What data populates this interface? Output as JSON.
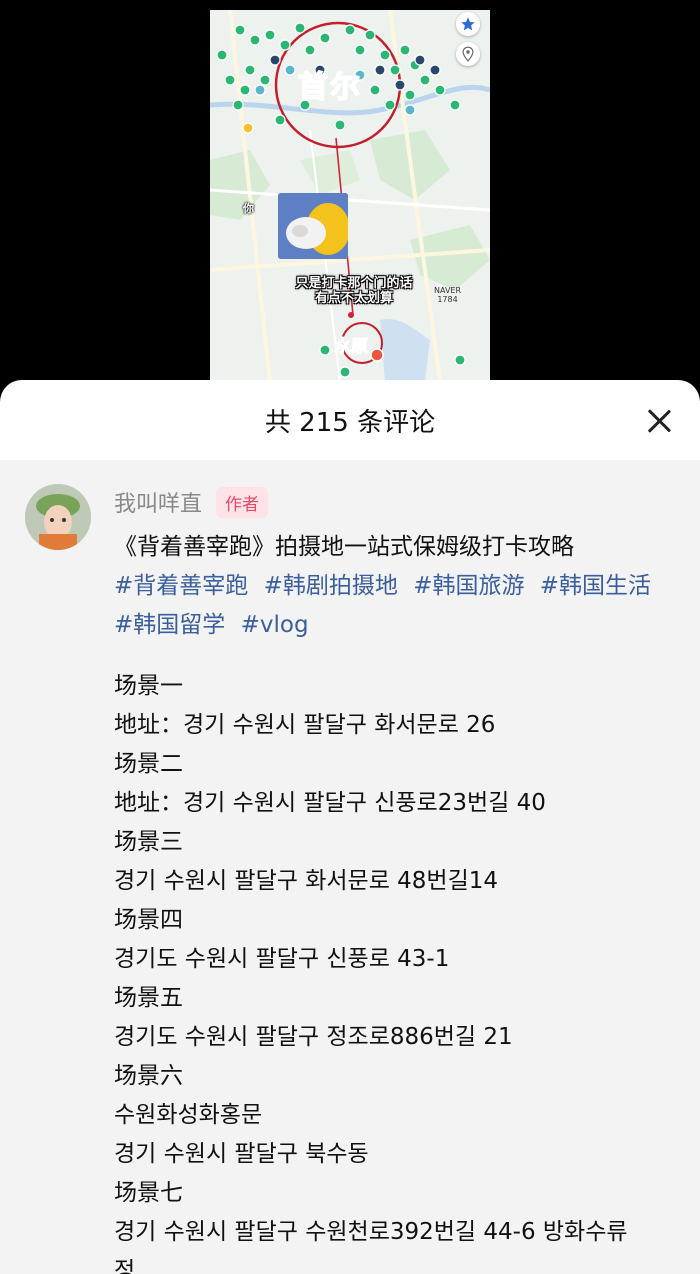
{
  "video": {
    "map_city_main": "首尔",
    "map_city_secondary": "水原",
    "sticker_text": "你",
    "caption_line1": "只是打卡那个门的话",
    "caption_line2": "有点不太划算",
    "map_poi_label": "NAVER\n1784"
  },
  "sheet": {
    "title": "共 215 条评论"
  },
  "comment": {
    "username": "我叫咩直",
    "author_tag": "作者",
    "intro": "《背着善宰跑》拍摄地一站式保姆级打卡攻略",
    "hashtags": [
      "#背着善宰跑",
      "#韩剧拍摄地",
      "#韩国旅游",
      "#韩国生活",
      "#韩国留学",
      "#vlog"
    ],
    "lines": [
      "场景一",
      "地址：경기 수원시 팔달구 화서문로 26",
      "场景二",
      "地址：경기 수원시 팔달구 신풍로23번길 40",
      "场景三",
      "경기 수원시 팔달구 화서문로 48번길14",
      "场景四",
      "경기도 수원시 팔달구 신풍로 43-1",
      "场景五",
      "경기도 수원시 팔달구 정조로886번길 21",
      "场景六",
      "수원화성화홍문",
      "경기 수원시 팔달구 북수동",
      "场景七",
      "경기 수원시 팔달구 수원천로392번길 44-6 방화수류",
      "정"
    ]
  },
  "colors": {
    "accent_pink": "#e8356e",
    "hashtag_blue": "#3a5f9b",
    "map_green": "#2bb673"
  }
}
